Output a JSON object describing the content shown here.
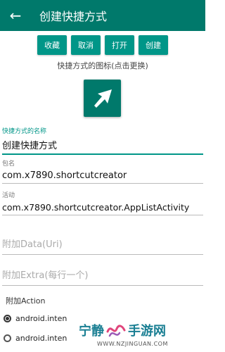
{
  "appbar": {
    "back_icon": "arrow-left-icon",
    "title": "创建快捷方式"
  },
  "buttons": [
    {
      "label": "收藏"
    },
    {
      "label": "取消"
    },
    {
      "label": "打开"
    },
    {
      "label": "创建"
    }
  ],
  "icon_hint": "快捷方式的图标(点击更换)",
  "shortcut_icon": {
    "name": "arrow-up-right-icon",
    "bg_color": "#00796b"
  },
  "fields": {
    "name": {
      "label": "快捷方式的名称",
      "value": "创建快捷方式"
    },
    "package": {
      "label": "包名",
      "value": "com.x7890.shortcutcreator"
    },
    "activity": {
      "label": "活动",
      "value": "com.x7890.shortcutcreator.AppListActivity"
    },
    "data_uri": {
      "placeholder": "附加Data(Uri)"
    },
    "extra": {
      "placeholder": "附加Extra(每行一个)"
    }
  },
  "action": {
    "label": "附加Action",
    "options": [
      {
        "text": "android.inten",
        "checked": true
      },
      {
        "text": "android.inten",
        "checked": false
      }
    ]
  },
  "watermark": {
    "text_left": "宁静",
    "text_right": "手游网",
    "url": "WWW.NZJINGUAN.COM"
  },
  "colors": {
    "primary_dark": "#00796b",
    "primary": "#009688"
  }
}
